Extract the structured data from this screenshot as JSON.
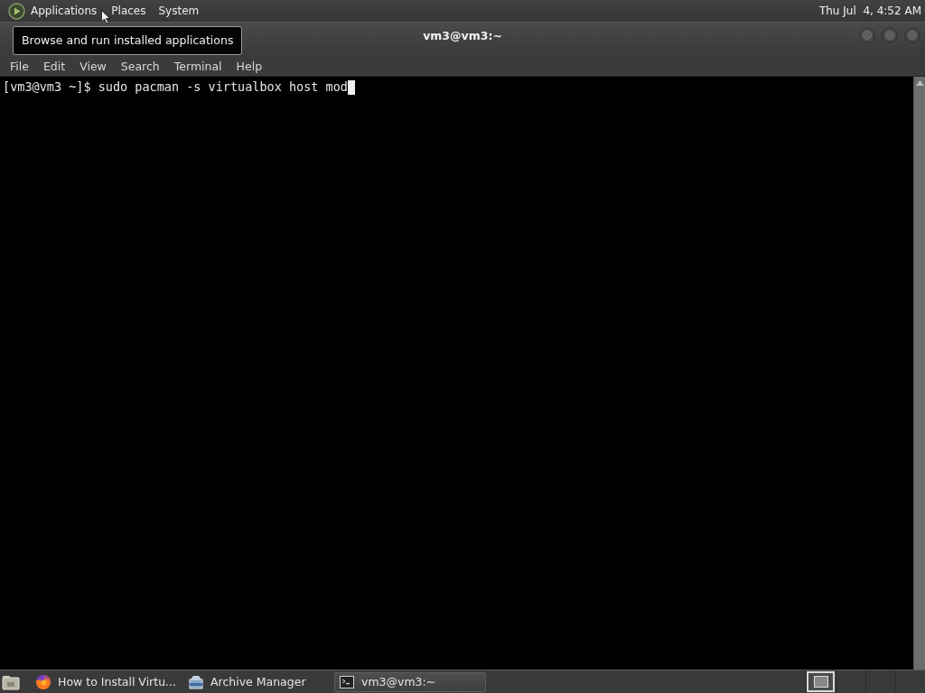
{
  "top_panel": {
    "menus": [
      {
        "label": "Applications"
      },
      {
        "label": "Places"
      },
      {
        "label": "System"
      }
    ],
    "clock": "Thu Jul  4, 4:52 AM"
  },
  "tooltip": {
    "text": "Browse and run installed applications"
  },
  "window": {
    "title": "vm3@vm3:~",
    "menu": [
      "File",
      "Edit",
      "View",
      "Search",
      "Terminal",
      "Help"
    ],
    "terminal": {
      "line": "[vm3@vm3 ~]$ sudo pacman -s virtualbox host mod"
    }
  },
  "taskbar": {
    "tasks": [
      {
        "kind": "browser",
        "label": "How to Install Virtu...",
        "selected": false
      },
      {
        "kind": "archive",
        "label": "Archive Manager",
        "selected": false
      },
      {
        "kind": "terminal",
        "label": "vm3@vm3:~",
        "selected": true
      }
    ],
    "workspaces": [
      {
        "selected": true
      },
      {
        "selected": false
      },
      {
        "selected": false
      },
      {
        "selected": false
      }
    ]
  }
}
